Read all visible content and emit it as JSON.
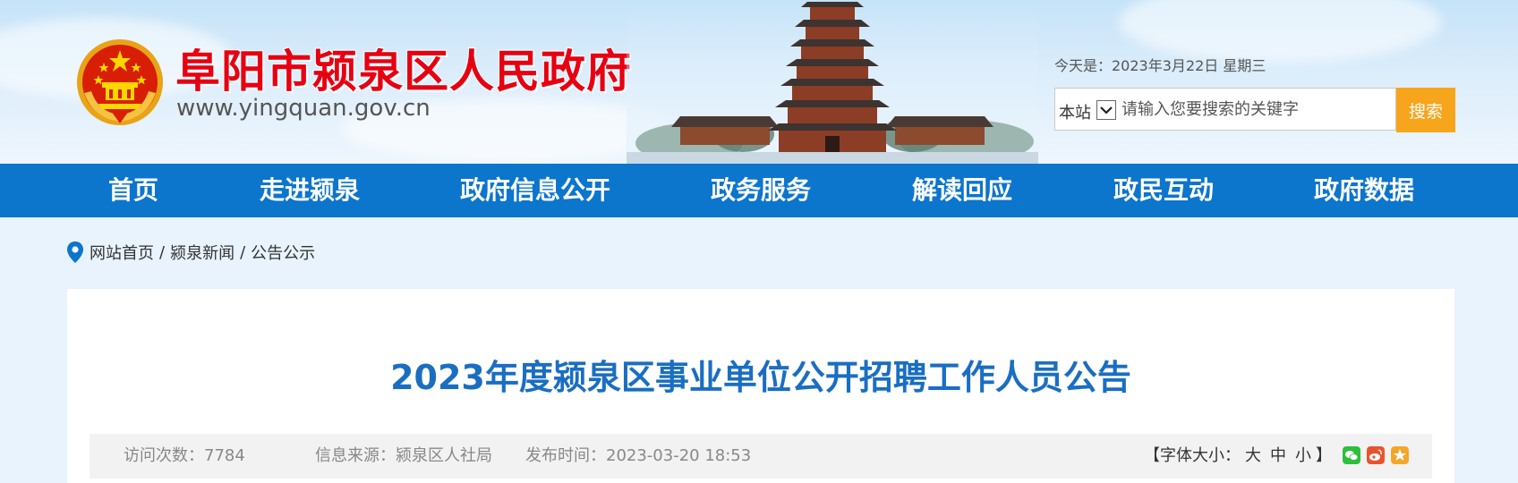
{
  "header": {
    "site_title": "阜阳市颍泉区人民政府",
    "site_url": "www.yingquan.gov.cn",
    "date_text": "今天是：2023年3月22日 星期三",
    "search": {
      "scope_label": "本站",
      "placeholder": "请输入您要搜索的关键字",
      "button_label": "搜索"
    }
  },
  "nav": {
    "items": [
      "首页",
      "走进颍泉",
      "政府信息公开",
      "政务服务",
      "解读回应",
      "政民互动",
      "政府数据"
    ]
  },
  "breadcrumb": {
    "items": [
      "网站首页",
      "颍泉新闻",
      "公告公示"
    ],
    "separator": "/"
  },
  "article": {
    "title": "2023年度颍泉区事业单位公开招聘工作人员公告",
    "meta": {
      "visits_label": "访问次数：",
      "visits_value": "7784",
      "source_label": "信息来源：",
      "source_value": "颍泉区人社局",
      "time_label": "发布时间：",
      "time_value": "2023-03-20 18:53"
    },
    "font_size": {
      "open": "【",
      "label": "字体大小：",
      "large": "大",
      "medium": "中",
      "small": "小",
      "close": "】"
    },
    "share_icons": [
      "wechat-icon",
      "weibo-icon",
      "favorite-icon"
    ]
  },
  "colors": {
    "nav_bg": "#0c75cc",
    "title_red": "#e60012",
    "article_title": "#1a6ec2",
    "search_button": "#f7a51b"
  }
}
